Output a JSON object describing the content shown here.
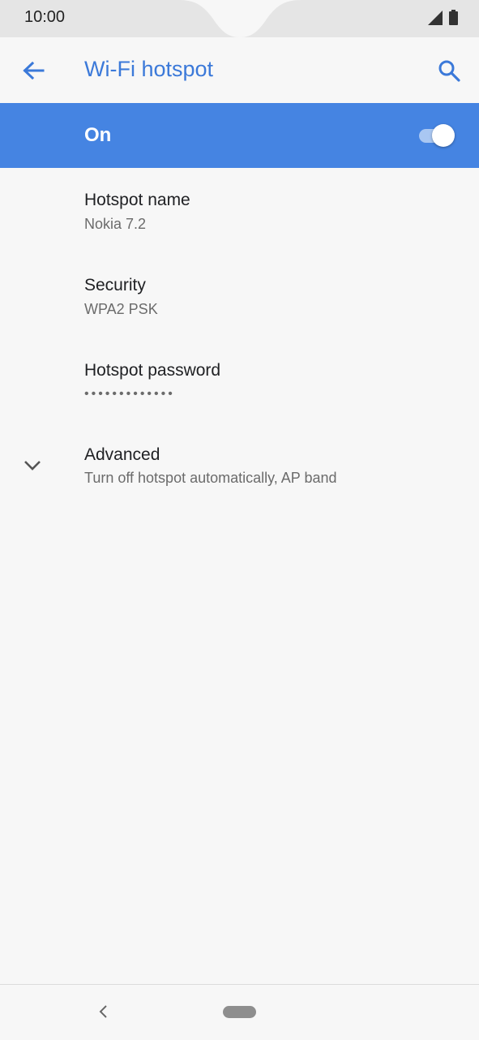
{
  "status_bar": {
    "time": "10:00",
    "icons": [
      "signal-icon",
      "battery-icon"
    ]
  },
  "app_bar": {
    "title": "Wi-Fi hotspot",
    "back_icon": "arrow-back-icon",
    "search_icon": "search-icon"
  },
  "toggle": {
    "label": "On",
    "state": true
  },
  "settings": [
    {
      "title": "Hotspot name",
      "value": "Nokia 7.2"
    },
    {
      "title": "Security",
      "value": "WPA2 PSK"
    },
    {
      "title": "Hotspot password",
      "value": "•••••••••••••"
    },
    {
      "title": "Advanced",
      "value": "Turn off hotspot automatically, AP band",
      "icon": "chevron-down-icon"
    }
  ],
  "nav_bar": {
    "back_icon": "nav-back-icon",
    "home_icon": "home-pill-icon"
  },
  "colors": {
    "accent": "#3b79d9",
    "banner": "#4584e2",
    "background": "#f7f7f7"
  }
}
